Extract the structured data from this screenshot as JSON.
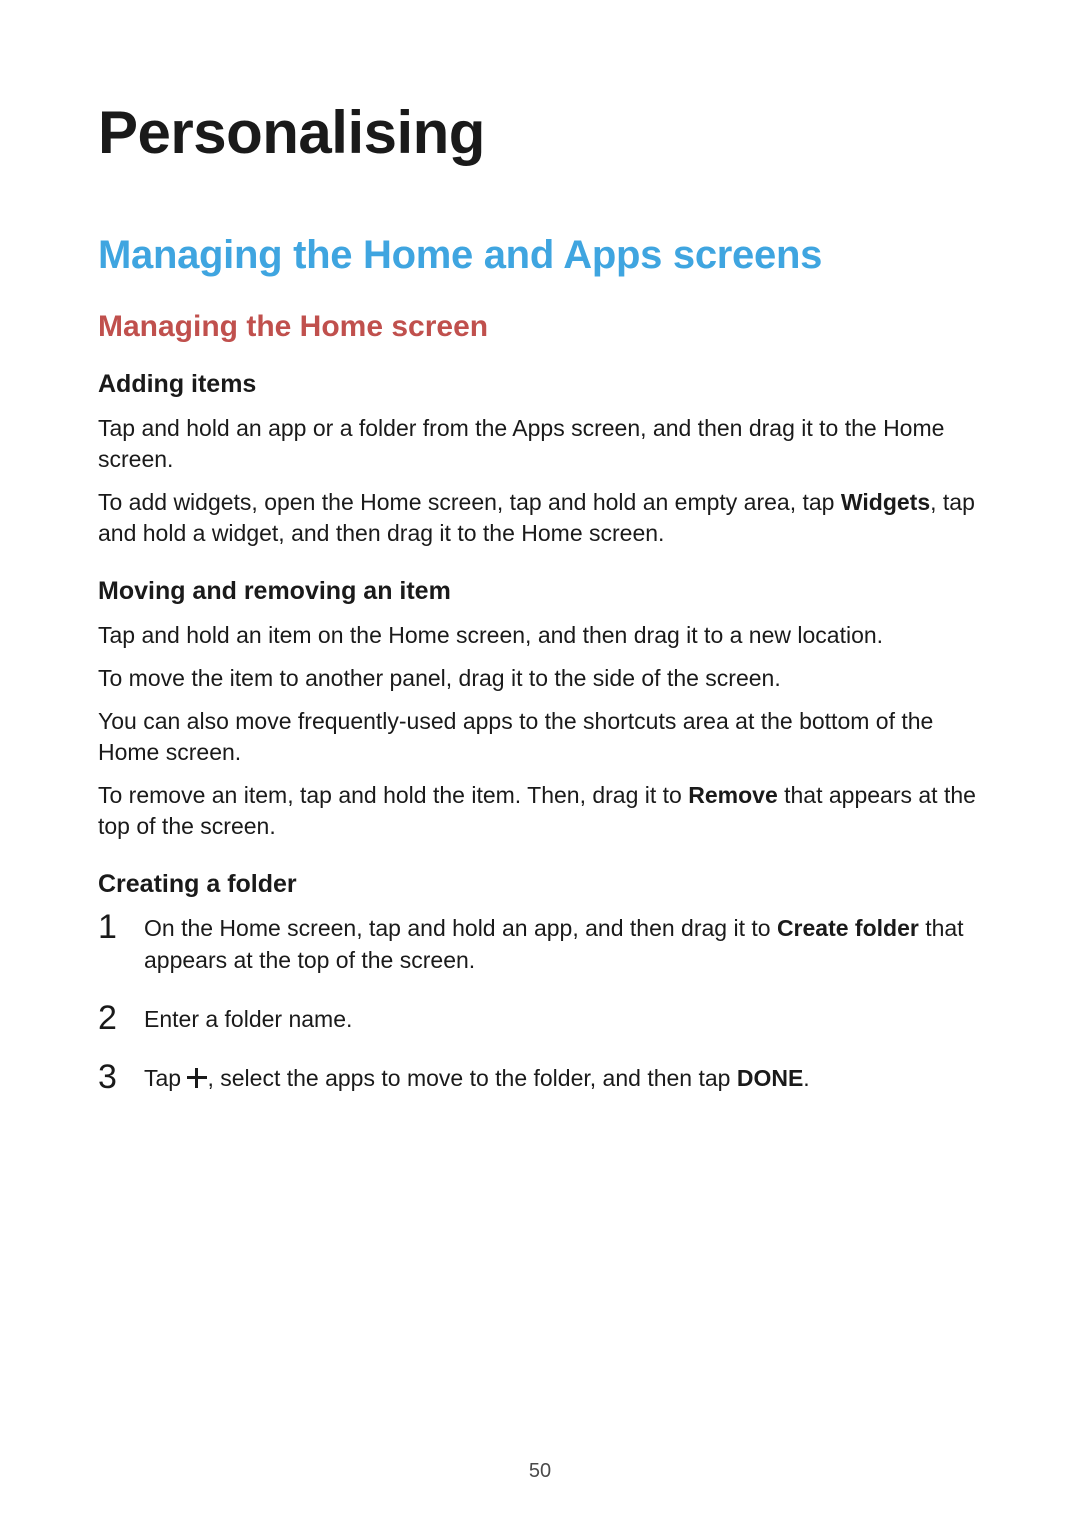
{
  "page_number": "50",
  "h1": "Personalising",
  "h2": "Managing the Home and Apps screens",
  "h3": "Managing the Home screen",
  "sections": {
    "adding_items": {
      "title": "Adding items",
      "p1": "Tap and hold an app or a folder from the Apps screen, and then drag it to the Home screen.",
      "p2_pre": "To add widgets, open the Home screen, tap and hold an empty area, tap ",
      "p2_bold": "Widgets",
      "p2_post": ", tap and hold a widget, and then drag it to the Home screen."
    },
    "moving_removing": {
      "title": "Moving and removing an item",
      "p1": "Tap and hold an item on the Home screen, and then drag it to a new location.",
      "p2": "To move the item to another panel, drag it to the side of the screen.",
      "p3": "You can also move frequently-used apps to the shortcuts area at the bottom of the Home screen.",
      "p4_pre": "To remove an item, tap and hold the item. Then, drag it to ",
      "p4_bold": "Remove",
      "p4_post": " that appears at the top of the screen."
    },
    "creating_folder": {
      "title": "Creating a folder",
      "step1_pre": "On the Home screen, tap and hold an app, and then drag it to ",
      "step1_bold": "Create folder",
      "step1_post": " that appears at the top of the screen.",
      "step2": "Enter a folder name.",
      "step3_pre": "Tap ",
      "step3_icon": "plus-icon",
      "step3_mid": ", select the apps to move to the folder, and then tap ",
      "step3_bold": "DONE",
      "step3_post": "."
    }
  }
}
